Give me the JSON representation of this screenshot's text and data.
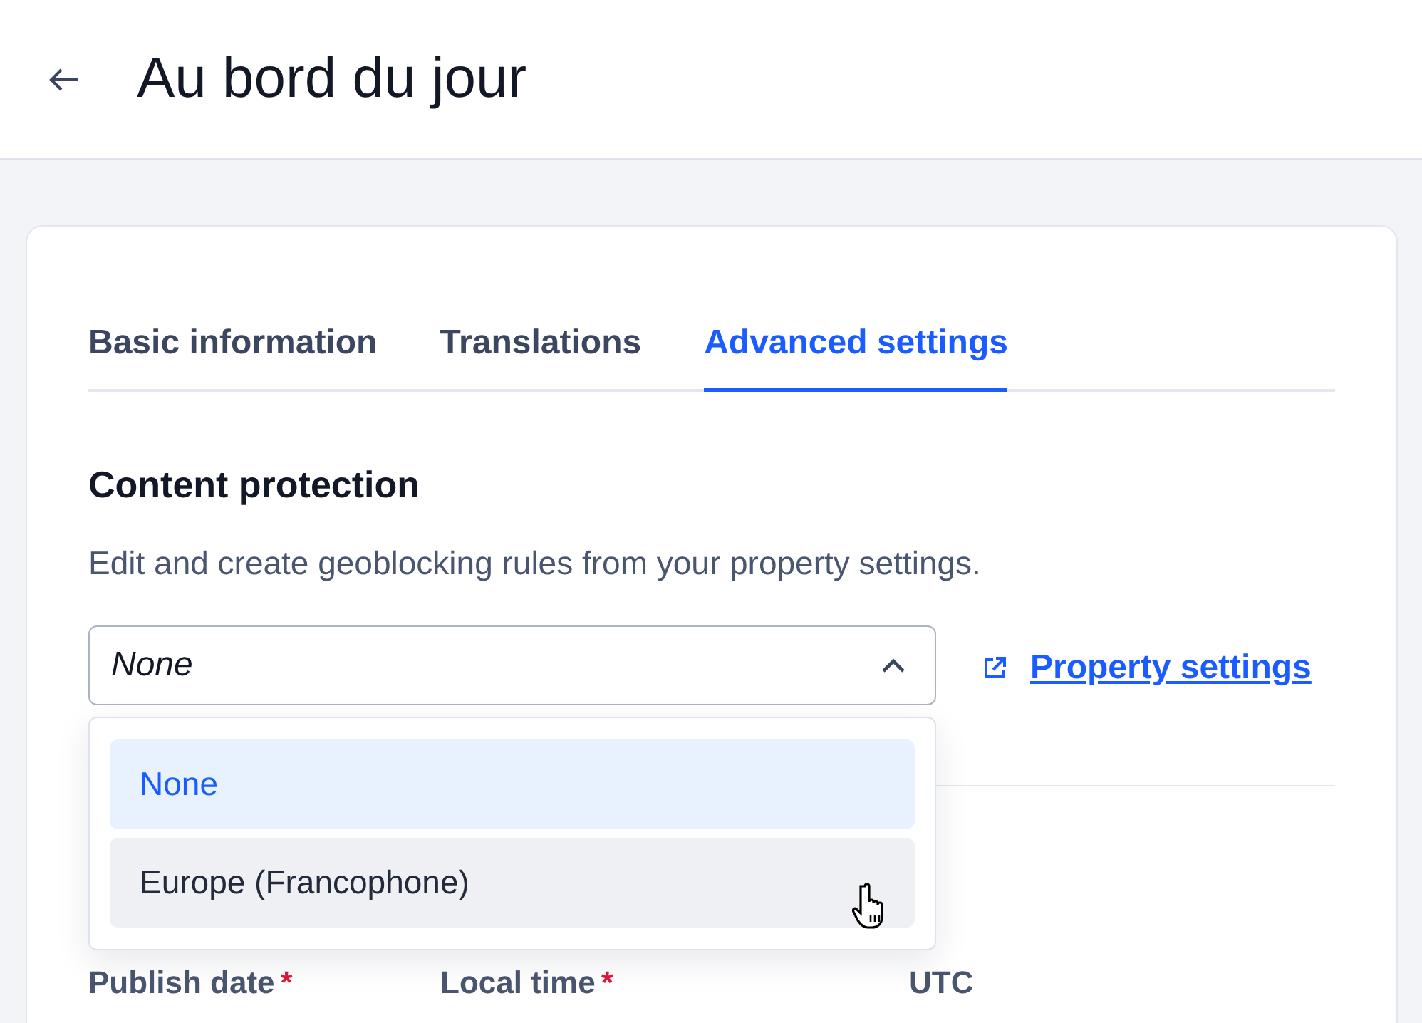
{
  "page": {
    "title": "Au bord du jour"
  },
  "tabs": [
    {
      "label": "Basic information",
      "selected": false
    },
    {
      "label": "Translations",
      "selected": false
    },
    {
      "label": "Advanced settings",
      "selected": true
    }
  ],
  "content_protection": {
    "heading": "Content protection",
    "description": "Edit and create geoblocking rules from your property settings.",
    "select": {
      "value": "None",
      "expanded": true,
      "options": [
        {
          "label": "None",
          "selected": true,
          "hovered": false
        },
        {
          "label": "Europe (Francophone)",
          "selected": false,
          "hovered": true
        }
      ]
    },
    "link": "Property settings"
  },
  "schedule": {
    "fields": [
      {
        "label": "Publish date",
        "required_mark": "*"
      },
      {
        "label": "Local time",
        "required_mark": "*"
      },
      {
        "label": "UTC"
      }
    ]
  }
}
